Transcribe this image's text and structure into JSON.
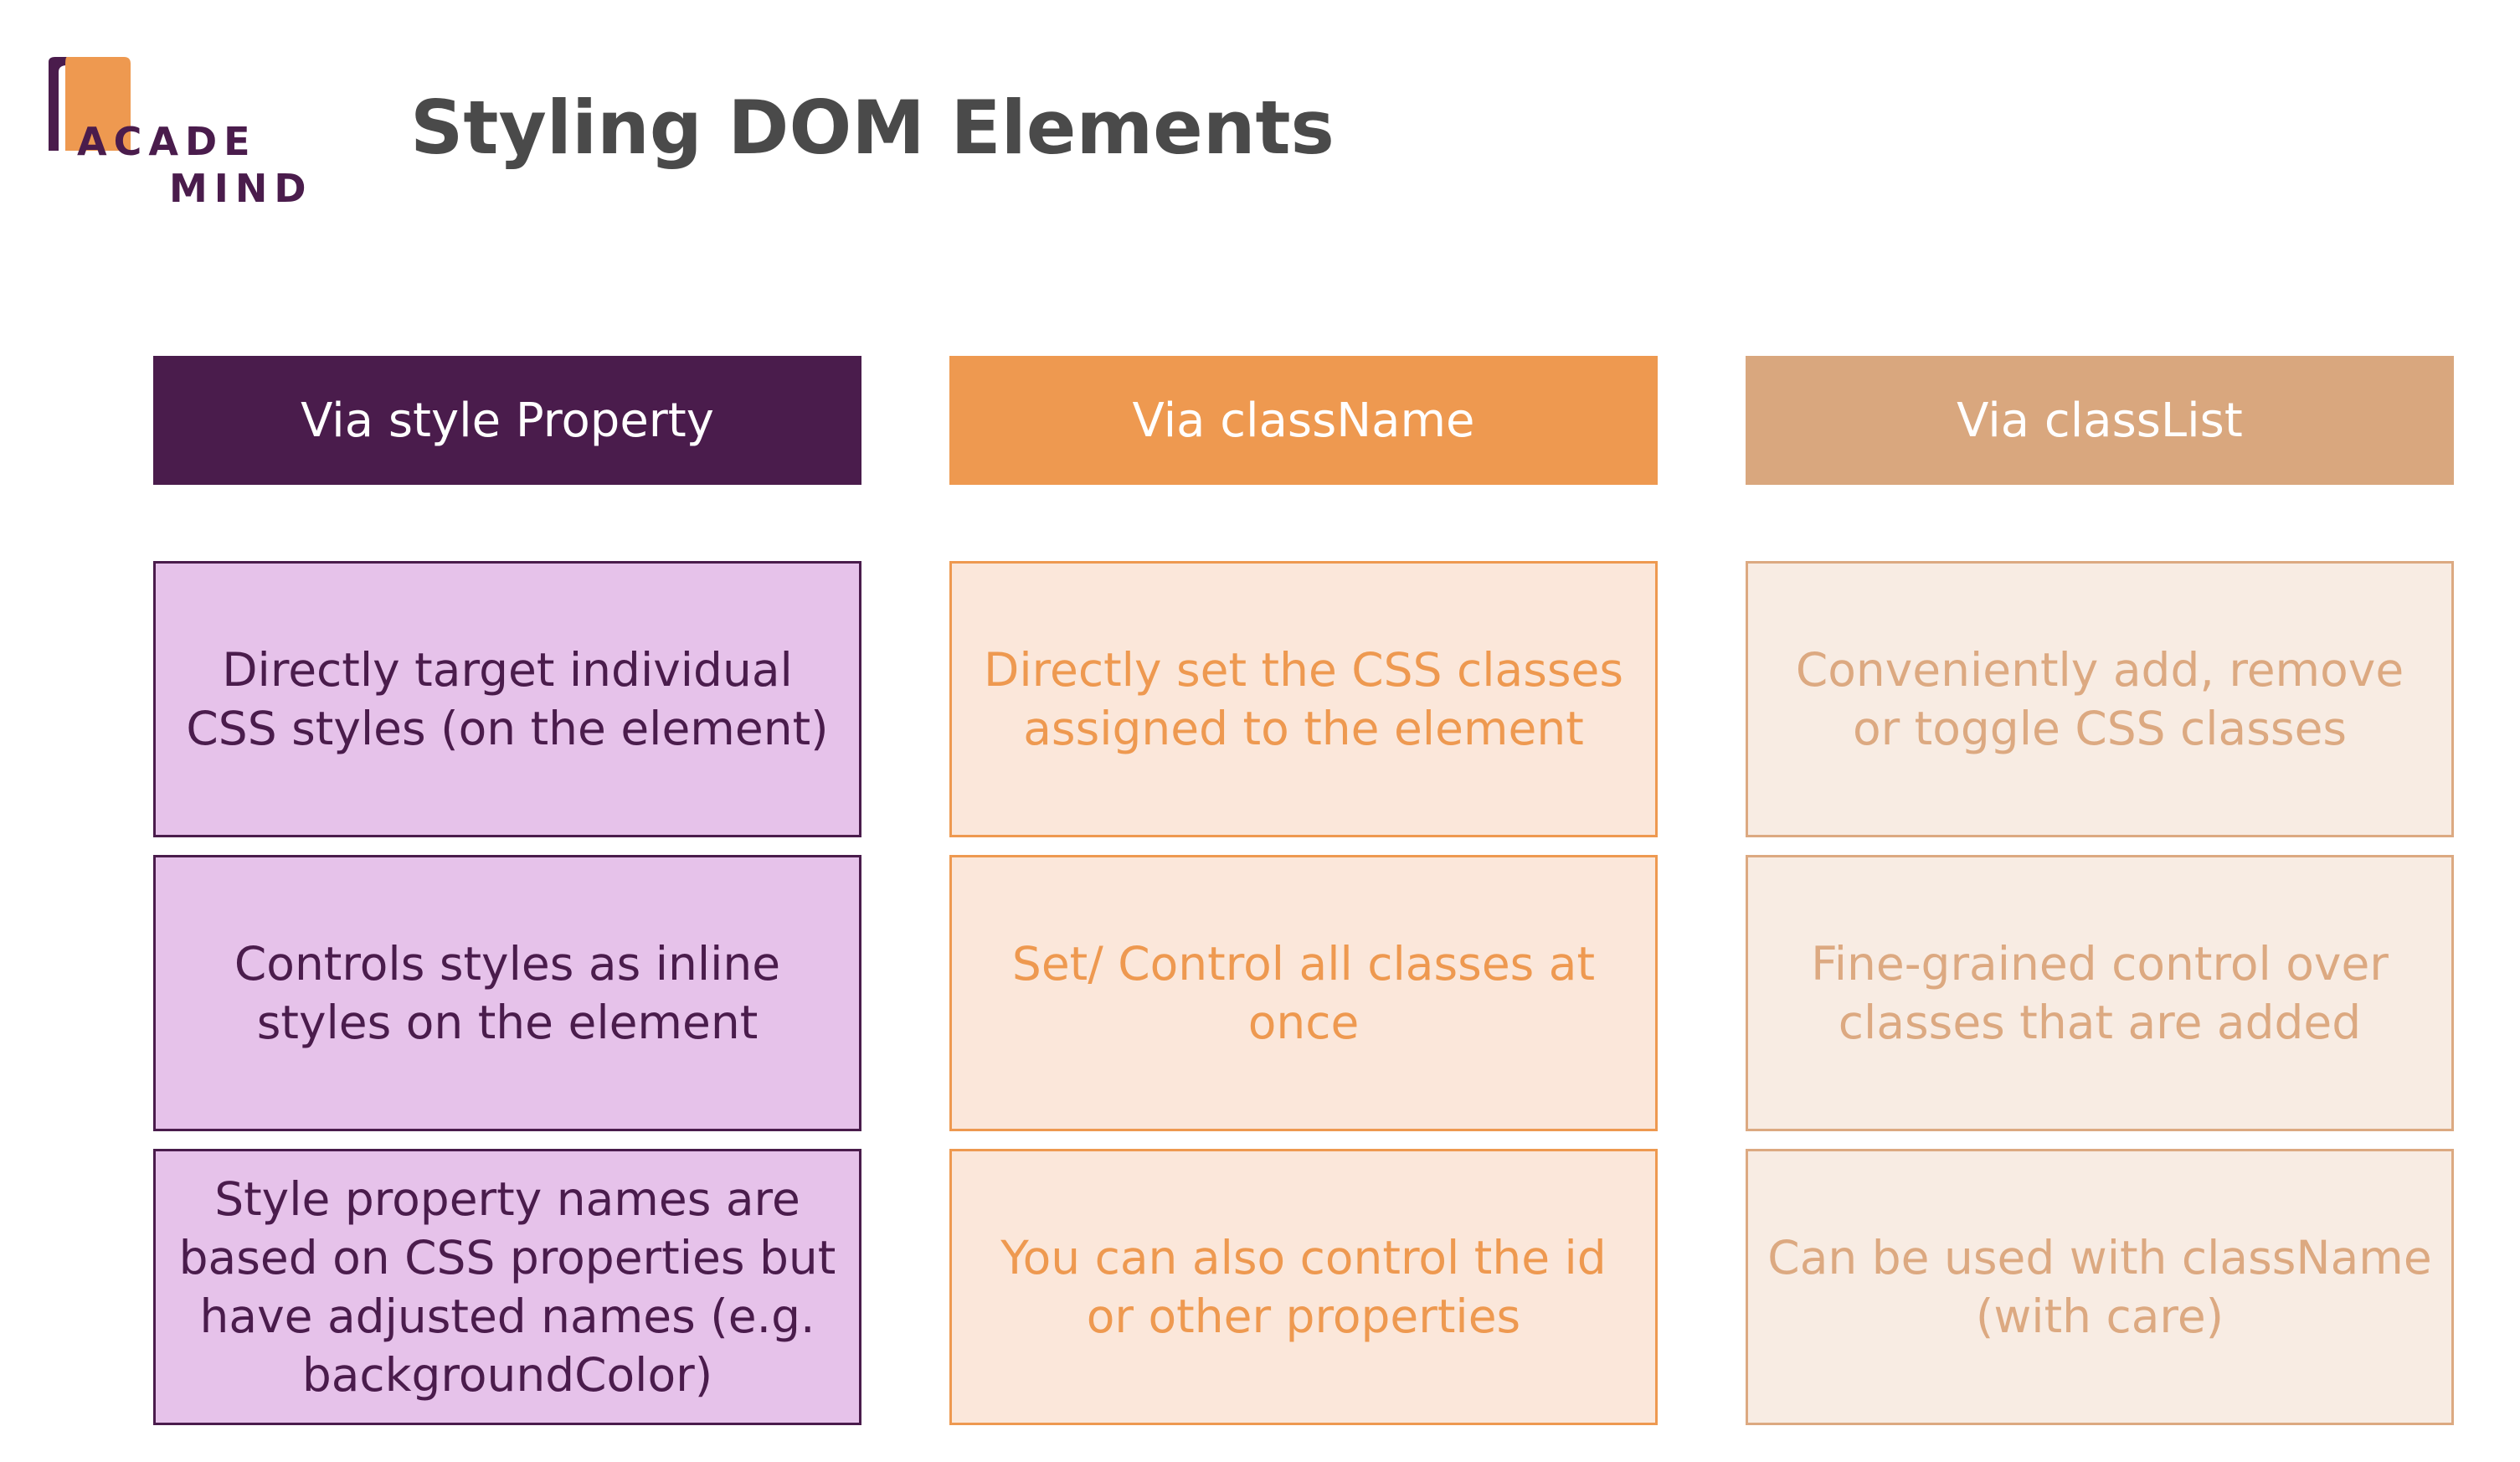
{
  "logo": {
    "line1": "ACADE",
    "line2": "MIND"
  },
  "title": "Styling DOM Elements",
  "colors": {
    "purple": "#4a1c4c",
    "orange": "#ee9950",
    "tan": "#d9a77e",
    "title": "#4a4a4a"
  },
  "columns": [
    {
      "header": "Via style Property",
      "cells": [
        "Directly target individual CSS styles (on the element)",
        "Controls styles as inline styles on the element",
        "Style property names are based on CSS properties but have adjusted names (e.g. backgroundColor)"
      ]
    },
    {
      "header": "Via className",
      "cells": [
        "Directly set the CSS classes assigned to the element",
        "Set/ Control all classes at once",
        "You can also control the id or other properties"
      ]
    },
    {
      "header": "Via classList",
      "cells": [
        "Conveniently add, remove or toggle CSS classes",
        "Fine-grained control over classes that are added",
        "Can be used with className (with care)"
      ]
    }
  ]
}
